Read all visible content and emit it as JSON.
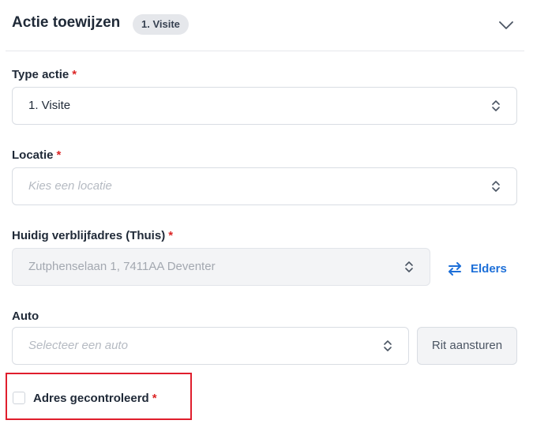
{
  "header": {
    "title": "Actie toewijzen",
    "badge": "1. Visite",
    "collapse_icon": "chevron-down-icon"
  },
  "type_actie": {
    "label": "Type actie",
    "required_marker": "*",
    "value": "1. Visite"
  },
  "locatie": {
    "label": "Locatie",
    "required_marker": "*",
    "placeholder": "Kies een locatie"
  },
  "verblijfadres": {
    "label": "Huidig verblijfadres (Thuis)",
    "required_marker": "*",
    "value": "Zutphenselaan 1, 7411AA Deventer",
    "disabled": true,
    "elders_label": "Elders",
    "elders_icon": "swap-arrows-icon"
  },
  "auto": {
    "label": "Auto",
    "placeholder": "Selecteer een auto",
    "rit_button_label": "Rit aansturen"
  },
  "adres_gecontroleerd": {
    "label": "Adres gecontroleerd",
    "required_marker": "*",
    "checked": false
  },
  "colors": {
    "required": "#dc2626",
    "link": "#1d6fd8",
    "highlight_border": "#e01e2d"
  }
}
